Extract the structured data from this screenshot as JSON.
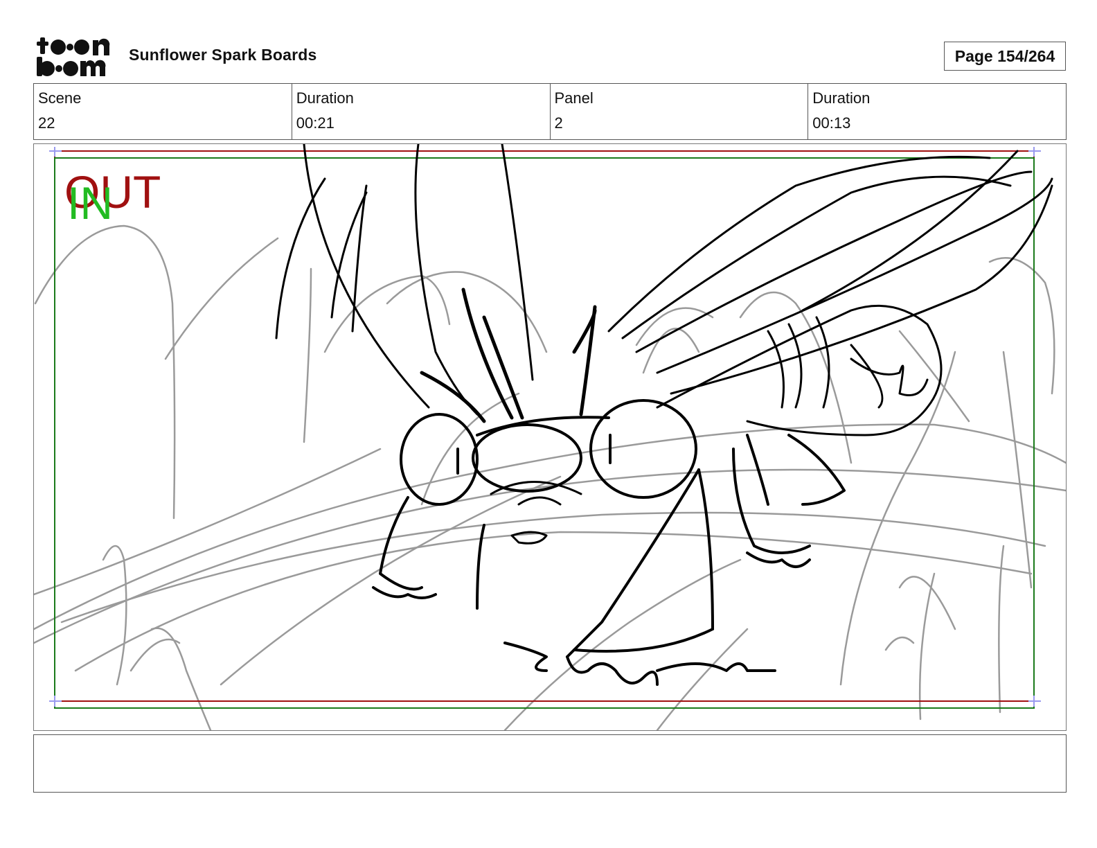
{
  "header": {
    "logo_alt": "toon boom",
    "project_title": "Sunflower Spark Boards",
    "page_label": "Page 154/264"
  },
  "info": [
    {
      "label": "Scene",
      "value": "22"
    },
    {
      "label": "Duration",
      "value": "00:21"
    },
    {
      "label": "Panel",
      "value": "2"
    },
    {
      "label": "Duration",
      "value": "00:13"
    }
  ],
  "panel": {
    "out_label": "OUT",
    "in_label": "IN",
    "colors": {
      "out_frame": "#a01010",
      "in_frame": "#1a7a1a",
      "sketch": "#000000",
      "background_sketch": "#9a9a9a"
    }
  },
  "notes": {
    "text": ""
  }
}
